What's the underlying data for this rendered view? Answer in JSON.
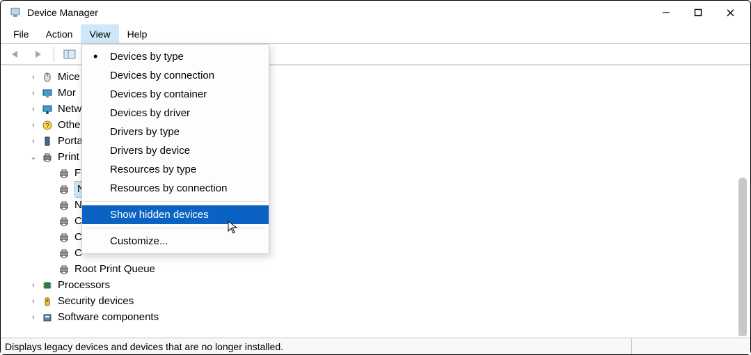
{
  "window": {
    "title": "Device Manager"
  },
  "menubar": {
    "items": [
      "File",
      "Action",
      "View",
      "Help"
    ],
    "open_index": 2
  },
  "view_menu": {
    "items": [
      {
        "label": "Devices by type",
        "checked": true
      },
      {
        "label": "Devices by connection",
        "checked": false
      },
      {
        "label": "Devices by container",
        "checked": false
      },
      {
        "label": "Devices by driver",
        "checked": false
      },
      {
        "label": "Drivers by type",
        "checked": false
      },
      {
        "label": "Drivers by device",
        "checked": false
      },
      {
        "label": "Resources by type",
        "checked": false
      },
      {
        "label": "Resources by connection",
        "checked": false
      }
    ],
    "show_hidden": "Show hidden devices",
    "customize": "Customize...",
    "highlighted": "show_hidden"
  },
  "tree": {
    "visible_nodes": [
      {
        "label": "Mice",
        "icon": "mouse",
        "indent": 0,
        "expander": ">"
      },
      {
        "label": "Mor",
        "icon": "monitor",
        "indent": 0,
        "expander": ">"
      },
      {
        "label": "Netw",
        "icon": "network",
        "indent": 0,
        "expander": ">"
      },
      {
        "label": "Othe",
        "icon": "other",
        "indent": 0,
        "expander": ">"
      },
      {
        "label": "Porta",
        "icon": "portable",
        "indent": 0,
        "expander": ">"
      },
      {
        "label": "Print",
        "icon": "printer-cat",
        "indent": 0,
        "expander": "v"
      },
      {
        "label": "F",
        "icon": "printer",
        "indent": 1,
        "expander": ""
      },
      {
        "label": "N",
        "icon": "printer",
        "indent": 1,
        "expander": "",
        "selected": true
      },
      {
        "label": "N",
        "icon": "printer",
        "indent": 1,
        "expander": ""
      },
      {
        "label": "C",
        "icon": "printer",
        "indent": 1,
        "expander": ""
      },
      {
        "label": "C",
        "icon": "printer",
        "indent": 1,
        "expander": ""
      },
      {
        "label": "C",
        "icon": "printer",
        "indent": 1,
        "expander": ""
      },
      {
        "label": "Root Print Queue",
        "icon": "printer",
        "indent": 1,
        "expander": ""
      },
      {
        "label": "Processors",
        "icon": "cpu",
        "indent": 0,
        "expander": ">"
      },
      {
        "label": "Security devices",
        "icon": "security",
        "indent": 0,
        "expander": ">"
      },
      {
        "label": "Software components",
        "icon": "software",
        "indent": 0,
        "expander": ">"
      }
    ]
  },
  "statusbar": {
    "text": "Displays legacy devices and devices that are no longer installed."
  }
}
